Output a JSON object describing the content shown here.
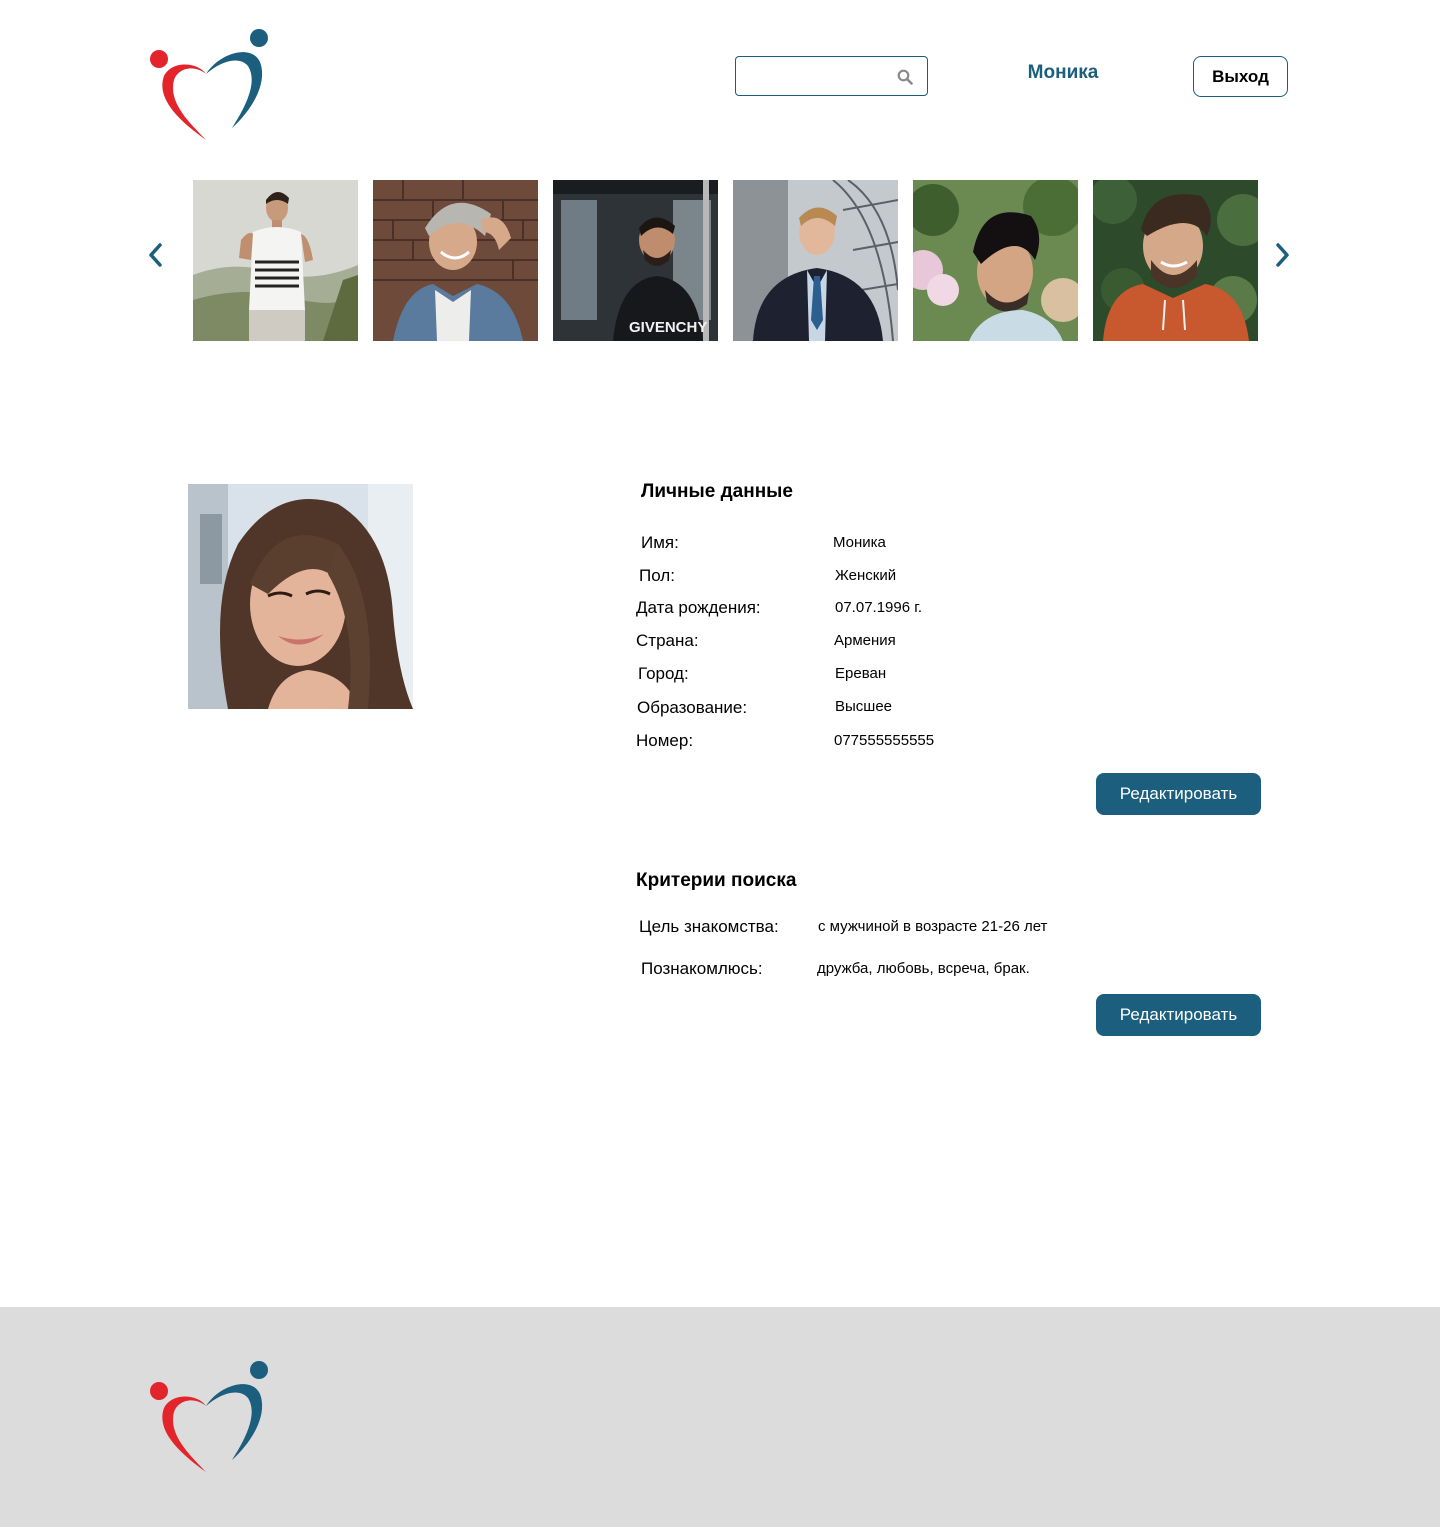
{
  "header": {
    "search": {
      "value": "",
      "placeholder": ""
    },
    "user_name": "Моника",
    "logout_label": "Выход"
  },
  "carousel": {
    "prev_icon": "chevron-left-icon",
    "next_icon": "chevron-right-icon",
    "photos": [
      "man-photo-1",
      "man-photo-2",
      "man-photo-3",
      "man-photo-4",
      "man-photo-5",
      "man-photo-6"
    ],
    "shirt_text": "GIVENCHY"
  },
  "personal": {
    "title": "Личные данные",
    "fields": [
      {
        "label": "Имя:",
        "value": "Моника"
      },
      {
        "label": "Пол:",
        "value": "Женский"
      },
      {
        "label": "Дата рождения:",
        "value": "07.07.1996 г."
      },
      {
        "label": "Страна:",
        "value": "Армения"
      },
      {
        "label": "Город:",
        "value": "Ереван"
      },
      {
        "label": "Образование:",
        "value": "Высшее"
      },
      {
        "label": "Номер:",
        "value": "077555555555"
      }
    ],
    "edit_label": "Редактировать"
  },
  "criteria": {
    "title": "Критерии поиска",
    "fields": [
      {
        "label": "Цель знакомства:",
        "value": "с мужчиной в возрасте 21-26 лет"
      },
      {
        "label": "Познакомлюсь:",
        "value": "дружба, любовь, всреча, брак."
      }
    ],
    "edit_label": "Редактировать"
  },
  "colors": {
    "accent": "#1b5e7d",
    "logo_red": "#e3242b",
    "footer_bg": "#dcdcdc"
  }
}
